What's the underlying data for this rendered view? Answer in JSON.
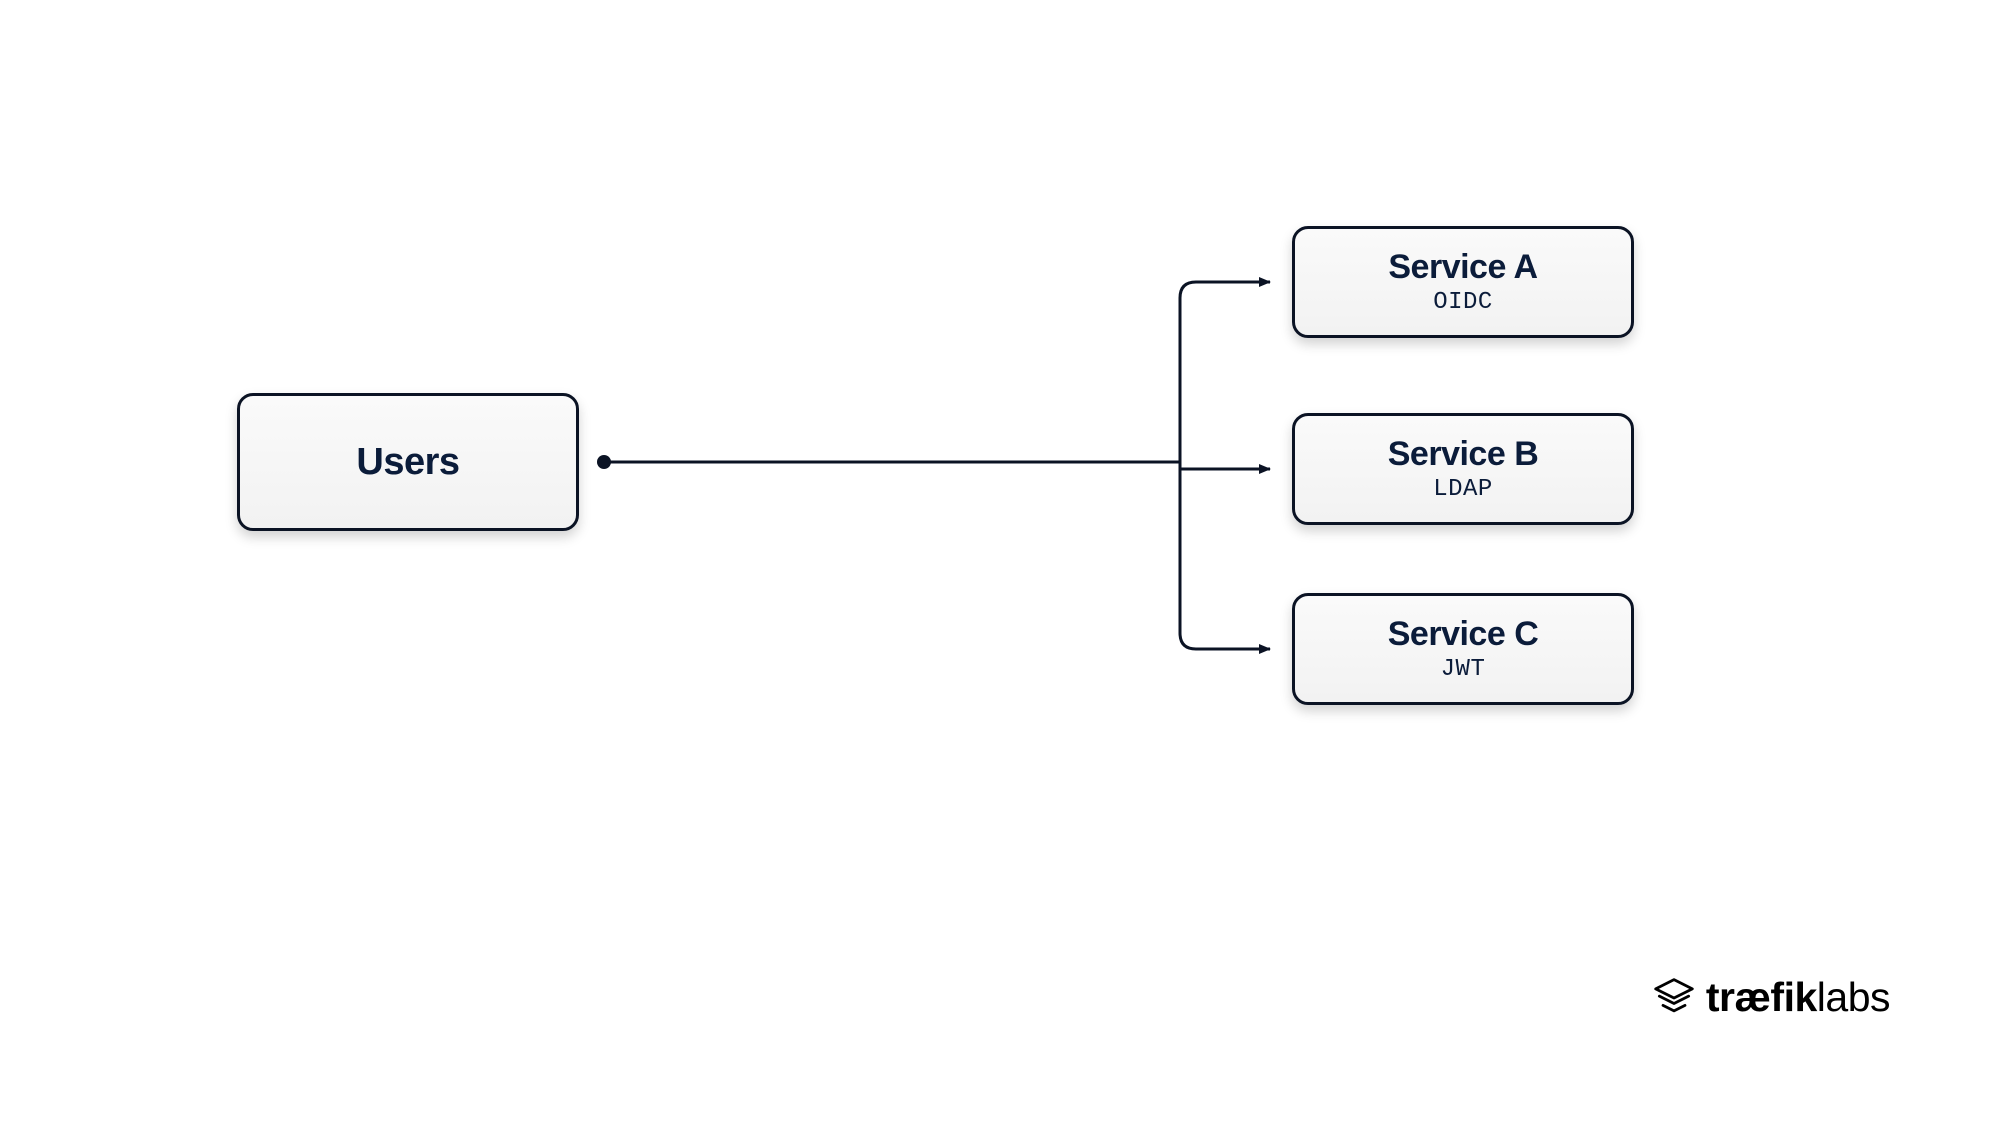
{
  "nodes": {
    "users": {
      "title": "Users"
    },
    "service_a": {
      "title": "Service A",
      "sub": "OIDC"
    },
    "service_b": {
      "title": "Service B",
      "sub": "LDAP"
    },
    "service_c": {
      "title": "Service C",
      "sub": "JWT"
    }
  },
  "brand": {
    "prefix": "træfik",
    "suffix": "labs"
  },
  "colors": {
    "stroke": "#0b1324"
  }
}
